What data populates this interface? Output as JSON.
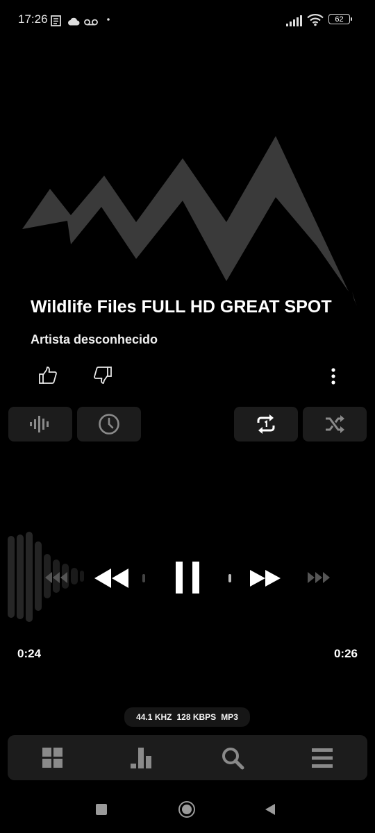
{
  "status_bar": {
    "time": "17:26",
    "battery": "62",
    "icons": [
      "notes-icon",
      "cloud-icon",
      "voicemail-icon",
      "dot-icon",
      "signal-icon",
      "wifi-icon",
      "battery-icon"
    ]
  },
  "track": {
    "title": "Wildlife Files FULL HD GREAT SPOT",
    "artist": "Artista desconhecido"
  },
  "actions": {
    "like_icon": "thumbs-up-icon",
    "dislike_icon": "thumbs-down-icon",
    "more_icon": "more-vertical-icon"
  },
  "chips": [
    "waveform-icon",
    "clock-icon",
    "repeat-one-icon",
    "shuffle-icon"
  ],
  "playback": {
    "elapsed": "0:24",
    "total": "0:26",
    "state": "playing",
    "progress": 0.92
  },
  "audio_info": {
    "sample_rate": "44.1 KHZ",
    "bitrate": "128 KBPS",
    "format": "MP3"
  },
  "bottom_nav": [
    "grid-icon",
    "bar-chart-icon",
    "search-icon",
    "menu-icon"
  ],
  "colors": {
    "background": "#000000",
    "surface": "#1c1c1c",
    "artwork": "#3a3a3a",
    "text": "#ffffff",
    "muted": "#8a8a8a"
  }
}
